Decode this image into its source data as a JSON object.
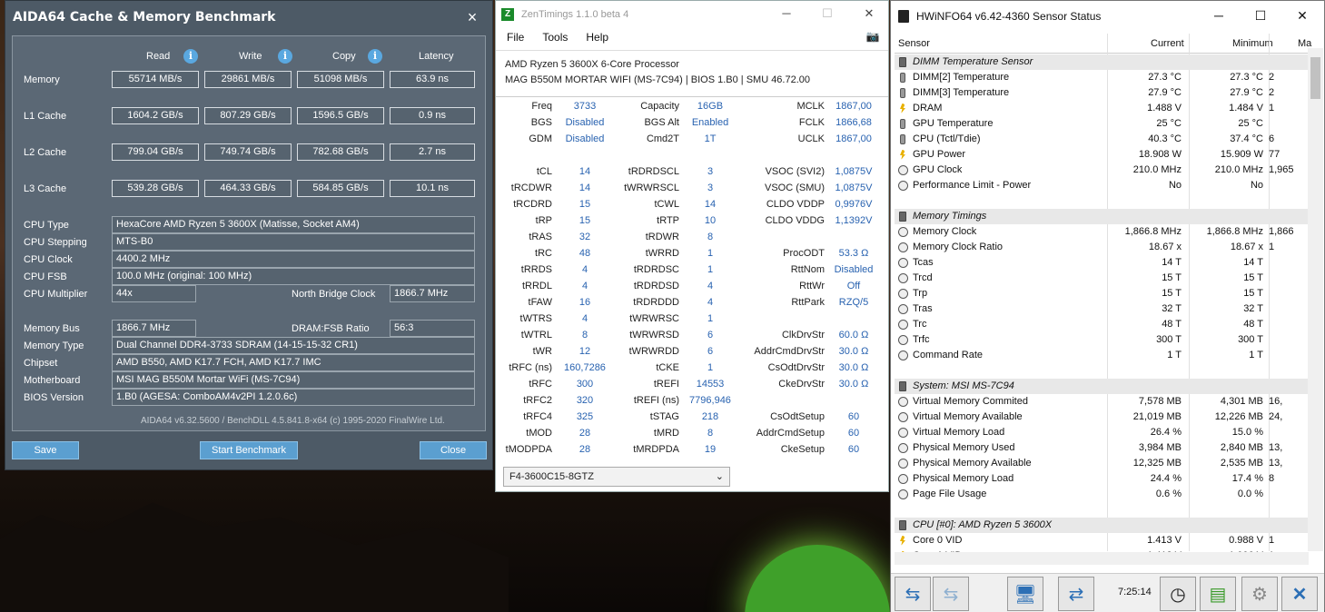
{
  "aida": {
    "title": "AIDA64 Cache & Memory Benchmark",
    "close_icon": "×",
    "col_read": "Read",
    "col_write": "Write",
    "col_copy": "Copy",
    "col_latency": "Latency",
    "info_glyph": "i",
    "rows": [
      {
        "label": "Memory",
        "read": "55714 MB/s",
        "write": "29861 MB/s",
        "copy": "51098 MB/s",
        "latency": "63.9 ns"
      },
      {
        "label": "L1 Cache",
        "read": "1604.2 GB/s",
        "write": "807.29 GB/s",
        "copy": "1596.5 GB/s",
        "latency": "0.9 ns"
      },
      {
        "label": "L2 Cache",
        "read": "799.04 GB/s",
        "write": "749.74 GB/s",
        "copy": "782.68 GB/s",
        "latency": "2.7 ns"
      },
      {
        "label": "L3 Cache",
        "read": "539.28 GB/s",
        "write": "464.33 GB/s",
        "copy": "584.85 GB/s",
        "latency": "10.1 ns"
      }
    ],
    "cpu_type_label": "CPU Type",
    "cpu_type": "HexaCore AMD Ryzen 5 3600X  (Matisse, Socket AM4)",
    "cpu_stepping_label": "CPU Stepping",
    "cpu_stepping": "MTS-B0",
    "cpu_clock_label": "CPU Clock",
    "cpu_clock": "4400.2 MHz",
    "cpu_fsb_label": "CPU FSB",
    "cpu_fsb": "100.0 MHz  (original: 100 MHz)",
    "cpu_mult_label": "CPU Multiplier",
    "cpu_mult": "44x",
    "nb_clock_label": "North Bridge Clock",
    "nb_clock": "1866.7 MHz",
    "mem_bus_label": "Memory Bus",
    "mem_bus": "1866.7 MHz",
    "dram_fsb_label": "DRAM:FSB Ratio",
    "dram_fsb": "56:3",
    "mem_type_label": "Memory Type",
    "mem_type": "Dual Channel DDR4-3733 SDRAM  (14-15-15-32 CR1)",
    "chipset_label": "Chipset",
    "chipset": "AMD B550, AMD K17.7 FCH, AMD K17.7 IMC",
    "mobo_label": "Motherboard",
    "mobo": "MSI MAG B550M Mortar WiFi (MS-7C94)",
    "bios_label": "BIOS Version",
    "bios": "1.B0  (AGESA: ComboAM4v2PI 1.2.0.6c)",
    "footer": "AIDA64 v6.32.5600 / BenchDLL 4.5.841.8-x64  (c) 1995-2020 FinalWire Ltd.",
    "save_label": "Save",
    "start_label": "Start Benchmark",
    "close_label": "Close"
  },
  "zen": {
    "title": "ZenTimings 1.1.0 beta 4",
    "icon_letter": "Z",
    "menu": [
      "File",
      "Tools",
      "Help"
    ],
    "cpu_name": "AMD Ryzen 5 3600X 6-Core Processor",
    "board": "MAG B550M MORTAR WIFI (MS-7C94) | BIOS 1.B0 | SMU 46.72.00",
    "top": [
      [
        "Freq",
        "3733",
        "Capacity",
        "16GB",
        "MCLK",
        "1867,00"
      ],
      [
        "BGS",
        "Disabled",
        "BGS Alt",
        "Enabled",
        "FCLK",
        "1866,68"
      ],
      [
        "GDM",
        "Disabled",
        "Cmd2T",
        "1T",
        "UCLK",
        "1867,00"
      ]
    ],
    "timings": [
      [
        "tCL",
        "14",
        "tRDRDSCL",
        "3",
        "VSOC (SVI2)",
        "1,0875V"
      ],
      [
        "tRCDWR",
        "14",
        "tWRWRSCL",
        "3",
        "VSOC (SMU)",
        "1,0875V"
      ],
      [
        "tRCDRD",
        "15",
        "tCWL",
        "14",
        "CLDO VDDP",
        "0,9976V"
      ],
      [
        "tRP",
        "15",
        "tRTP",
        "10",
        "CLDO VDDG",
        "1,1392V"
      ],
      [
        "tRAS",
        "32",
        "tRDWR",
        "8",
        "",
        ""
      ],
      [
        "tRC",
        "48",
        "tWRRD",
        "1",
        "ProcODT",
        "53.3 Ω"
      ],
      [
        "tRRDS",
        "4",
        "tRDRDSC",
        "1",
        "RttNom",
        "Disabled"
      ],
      [
        "tRRDL",
        "4",
        "tRDRDSD",
        "4",
        "RttWr",
        "Off"
      ],
      [
        "tFAW",
        "16",
        "tRDRDDD",
        "4",
        "RttPark",
        "RZQ/5"
      ],
      [
        "tWTRS",
        "4",
        "tWRWRSC",
        "1",
        "",
        ""
      ],
      [
        "tWTRL",
        "8",
        "tWRWRSD",
        "6",
        "ClkDrvStr",
        "60.0 Ω"
      ],
      [
        "tWR",
        "12",
        "tWRWRDD",
        "6",
        "AddrCmdDrvStr",
        "30.0 Ω"
      ],
      [
        "tRFC (ns)",
        "160,7286",
        "tCKE",
        "1",
        "CsOdtDrvStr",
        "30.0 Ω"
      ],
      [
        "tRFC",
        "300",
        "tREFI",
        "14553",
        "CkeDrvStr",
        "30.0 Ω"
      ],
      [
        "tRFC2",
        "320",
        "tREFI (ns)",
        "7796,946",
        "",
        ""
      ],
      [
        "tRFC4",
        "325",
        "tSTAG",
        "218",
        "CsOdtSetup",
        "60"
      ],
      [
        "tMOD",
        "28",
        "tMRD",
        "8",
        "AddrCmdSetup",
        "60"
      ],
      [
        "tMODPDA",
        "28",
        "tMRDPDA",
        "19",
        "CkeSetup",
        "60"
      ]
    ],
    "module": "F4-3600C15-8GTZ",
    "min_icon": "─",
    "max_icon": "☐",
    "close_icon": "✕",
    "camera_icon": "📷",
    "dropdown_icon": "⌄"
  },
  "hw": {
    "title": "HWiNFO64 v6.42-4360 Sensor Status",
    "col_sensor": "Sensor",
    "col_current": "Current",
    "col_min": "Minimum",
    "col_max": "Ma",
    "min_icon": "─",
    "max_icon": "☐",
    "close_icon": "✕",
    "rows": [
      {
        "g": 1,
        "name": "DIMM Temperature Sensor"
      },
      {
        "i": "th",
        "name": "DIMM[2] Temperature",
        "cur": "27.3 °C",
        "min": "27.3 °C",
        "max": "2"
      },
      {
        "i": "th",
        "name": "DIMM[3] Temperature",
        "cur": "27.9 °C",
        "min": "27.9 °C",
        "max": "2"
      },
      {
        "i": "bolt",
        "name": "DRAM",
        "cur": "1.488 V",
        "min": "1.484 V",
        "max": "1"
      },
      {
        "i": "th",
        "name": "GPU Temperature",
        "cur": "25 °C",
        "min": "25 °C",
        "max": ""
      },
      {
        "i": "th",
        "name": "CPU (Tctl/Tdie)",
        "cur": "40.3 °C",
        "min": "37.4 °C",
        "max": "6"
      },
      {
        "i": "bolt",
        "name": "GPU Power",
        "cur": "18.908 W",
        "min": "15.909 W",
        "max": "77"
      },
      {
        "i": "c",
        "name": "GPU Clock",
        "cur": "210.0 MHz",
        "min": "210.0 MHz",
        "max": "1,965"
      },
      {
        "i": "c",
        "name": "Performance Limit - Power",
        "cur": "No",
        "min": "No",
        "max": ""
      },
      {
        "blank": 1
      },
      {
        "g": 1,
        "name": "Memory Timings"
      },
      {
        "i": "c",
        "name": "Memory Clock",
        "cur": "1,866.8 MHz",
        "min": "1,866.8 MHz",
        "max": "1,866"
      },
      {
        "i": "c",
        "name": "Memory Clock Ratio",
        "cur": "18.67 x",
        "min": "18.67 x",
        "max": "1"
      },
      {
        "i": "c",
        "name": "Tcas",
        "cur": "14 T",
        "min": "14 T",
        "max": ""
      },
      {
        "i": "c",
        "name": "Trcd",
        "cur": "15 T",
        "min": "15 T",
        "max": ""
      },
      {
        "i": "c",
        "name": "Trp",
        "cur": "15 T",
        "min": "15 T",
        "max": ""
      },
      {
        "i": "c",
        "name": "Tras",
        "cur": "32 T",
        "min": "32 T",
        "max": ""
      },
      {
        "i": "c",
        "name": "Trc",
        "cur": "48 T",
        "min": "48 T",
        "max": ""
      },
      {
        "i": "c",
        "name": "Trfc",
        "cur": "300 T",
        "min": "300 T",
        "max": ""
      },
      {
        "i": "c",
        "name": "Command Rate",
        "cur": "1 T",
        "min": "1 T",
        "max": ""
      },
      {
        "blank": 1
      },
      {
        "g": 1,
        "name": "System: MSI MS-7C94"
      },
      {
        "i": "c",
        "name": "Virtual Memory Commited",
        "cur": "7,578 MB",
        "min": "4,301 MB",
        "max": "16,"
      },
      {
        "i": "c",
        "name": "Virtual Memory Available",
        "cur": "21,019 MB",
        "min": "12,226 MB",
        "max": "24,"
      },
      {
        "i": "c",
        "name": "Virtual Memory Load",
        "cur": "26.4 %",
        "min": "15.0 %",
        "max": ""
      },
      {
        "i": "c",
        "name": "Physical Memory Used",
        "cur": "3,984 MB",
        "min": "2,840 MB",
        "max": "13,"
      },
      {
        "i": "c",
        "name": "Physical Memory Available",
        "cur": "12,325 MB",
        "min": "2,535 MB",
        "max": "13,"
      },
      {
        "i": "c",
        "name": "Physical Memory Load",
        "cur": "24.4 %",
        "min": "17.4 %",
        "max": "8"
      },
      {
        "i": "c",
        "name": "Page File Usage",
        "cur": "0.6 %",
        "min": "0.0 %",
        "max": ""
      },
      {
        "blank": 1
      },
      {
        "g": 1,
        "name": "CPU [#0]: AMD Ryzen 5 3600X"
      },
      {
        "i": "bolt",
        "name": "Core 0 VID",
        "cur": "1.413 V",
        "min": "0.988 V",
        "max": "1"
      },
      {
        "i": "bolt",
        "name": "Core 1 VID",
        "cur": "1.412 V",
        "min": "1.006 V",
        "max": "1"
      }
    ],
    "time": "7:25:14",
    "icons": [
      "arrows-lr-icon",
      "arrows-lr-disabled-icon",
      "monitor-search-icon",
      "network-icon",
      "clock-icon",
      "add-report-icon",
      "settings-gear-icon",
      "close-x-icon"
    ]
  }
}
